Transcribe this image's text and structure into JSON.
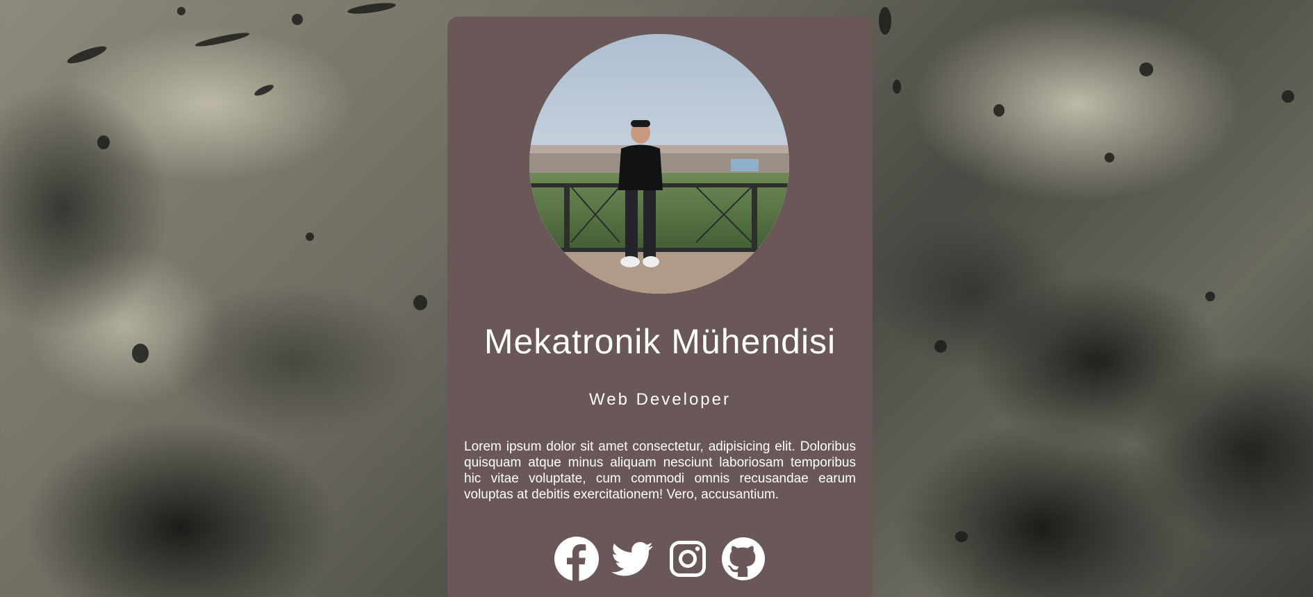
{
  "profile": {
    "photo_alt": "profile-photo",
    "title": "Mekatronik Mühendisi",
    "subtitle": "Web Developer",
    "bio": "Lorem ipsum dolor sit amet consectetur, adipisicing elit. Doloribus quisquam atque minus aliquam nesciunt laboriosam temporibus hic vitae voluptate, cum commodi omnis recusandae earum voluptas at debitis exercitationem! Vero, accusantium."
  },
  "socials": [
    {
      "icon": "facebook-icon"
    },
    {
      "icon": "twitter-icon"
    },
    {
      "icon": "instagram-icon"
    },
    {
      "icon": "github-icon"
    }
  ],
  "colors": {
    "card_background": "#6a5758",
    "text": "#ffffff"
  }
}
